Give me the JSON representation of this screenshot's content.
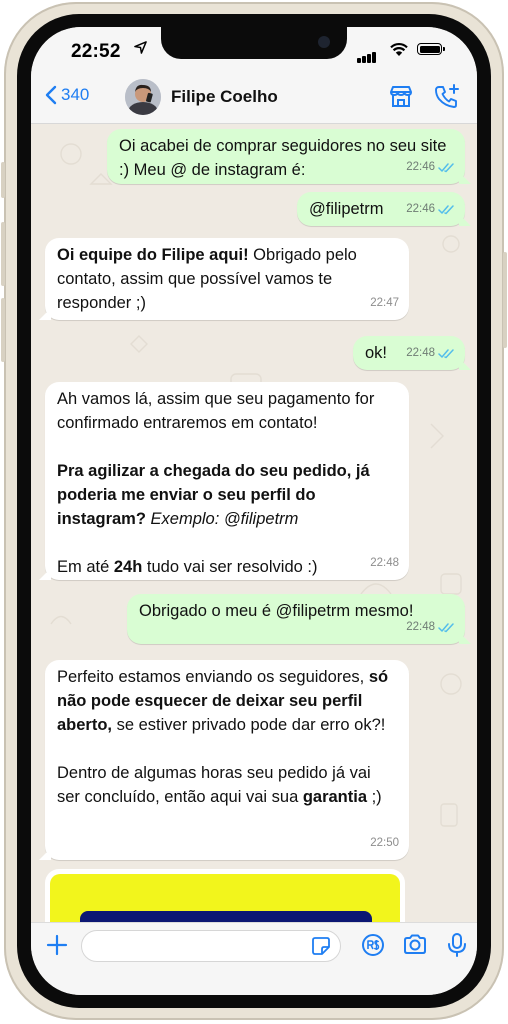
{
  "status_bar": {
    "time": "22:52"
  },
  "header": {
    "back_count": "340",
    "contact_name": "Filipe Coelho"
  },
  "messages": [
    {
      "direction": "out",
      "text": "Oi acabei de comprar seguidores no seu site :) Meu @ de instagram é:",
      "time": "22:46",
      "status": "read"
    },
    {
      "direction": "out",
      "text": "@filipetrm",
      "time": "22:46",
      "status": "read"
    },
    {
      "direction": "in",
      "bold": "Oi equipe do Filipe aqui!",
      "text": " Obrigado pelo contato, assim que possível vamos te responder ;)",
      "time": "22:47"
    },
    {
      "direction": "out",
      "text": "ok!",
      "time": "22:48",
      "status": "read"
    },
    {
      "direction": "in",
      "line1": "Ah vamos lá, assim que seu pagamento for confirmado entraremos em contato!",
      "bold": "Pra agilizar a chegada do seu pedido, já poderia me enviar o seu perfil do instagram?",
      "italic": " Exemplo: @filipetrm",
      "line3_a": "Em até ",
      "line3_bold": "24h",
      "line3_b": " tudo vai ser resolvido :)",
      "time": "22:48"
    },
    {
      "direction": "out",
      "text": "Obrigado o meu é @filipetrm mesmo!",
      "time": "22:48",
      "status": "read"
    },
    {
      "direction": "in",
      "p1_a": "Perfeito estamos enviando os seguidores, ",
      "p1_bold": "só não pode esquecer de deixar seu perfil aberto,",
      "p1_b": " se estiver privado pode dar erro ok?!",
      "p2_a": "Dentro de algumas horas seu pedido já vai ser concluído, então aqui vai sua ",
      "p2_bold": "garantia",
      "p2_b": " ;)",
      "time": "22:50"
    }
  ],
  "colors": {
    "accent": "#1f7ef2",
    "outgoing_bubble": "#d9fdd3",
    "incoming_bubble": "#ffffff",
    "chat_bg": "#efeae2",
    "read_ticks": "#53bdeb",
    "image_yellow": "#f2f51c",
    "image_navy": "#0c1773"
  },
  "icons": {
    "back": "chevron-left-icon",
    "location": "location-arrow-icon",
    "store": "store-icon",
    "call": "add-call-icon",
    "attach": "plus-icon",
    "sticker": "sticker-icon",
    "payment": "payment-icon",
    "camera": "camera-icon",
    "mic": "microphone-icon"
  }
}
